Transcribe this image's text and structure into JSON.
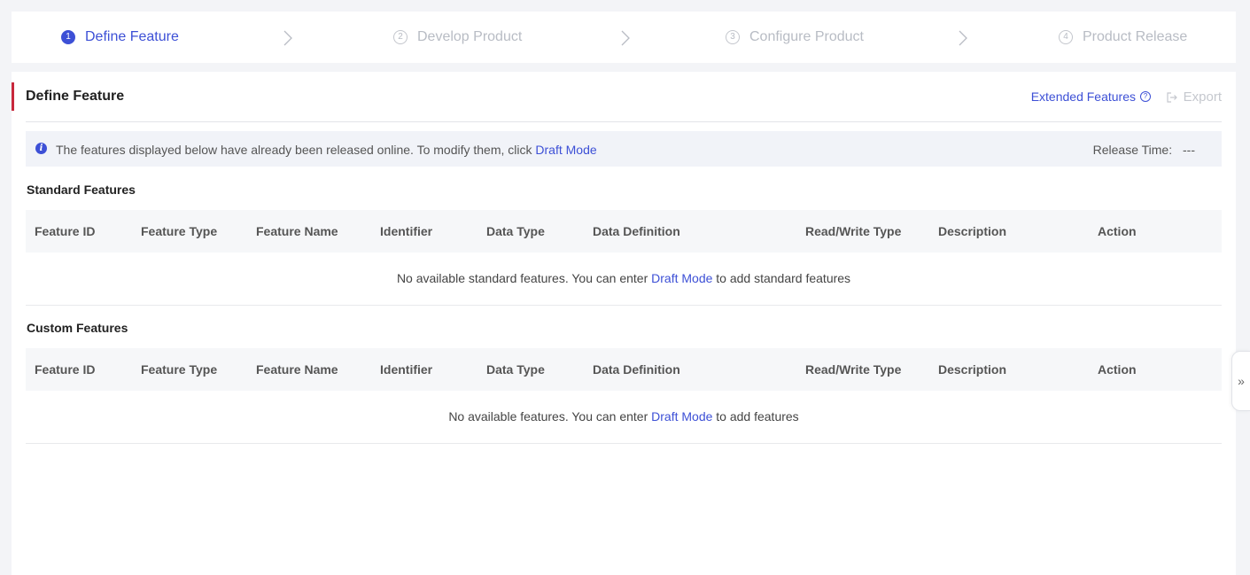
{
  "steps": [
    {
      "num": "1",
      "label": "Define Feature"
    },
    {
      "num": "2",
      "label": "Develop Product"
    },
    {
      "num": "3",
      "label": "Configure Product"
    },
    {
      "num": "4",
      "label": "Product Release"
    }
  ],
  "header": {
    "title": "Define Feature",
    "extended_label": "Extended Features",
    "help_glyph": "?",
    "export_label": "Export"
  },
  "notice": {
    "info_glyph": "i",
    "message": "The features displayed below have already been released online. To modify them, click",
    "draft_link": "Draft Mode",
    "release_label": "Release Time:",
    "release_value": "---"
  },
  "columns": [
    "Feature ID",
    "Feature Type",
    "Feature Name",
    "Identifier",
    "Data Type",
    "Data Definition",
    "Read/Write Type",
    "Description",
    "Action"
  ],
  "standard": {
    "title": "Standard Features",
    "empty_prefix": "No available standard features. You can enter",
    "empty_link": "Draft Mode",
    "empty_suffix": "to add standard features"
  },
  "custom": {
    "title": "Custom Features",
    "empty_prefix": "No available features. You can enter",
    "empty_link": "Draft Mode",
    "empty_suffix": "to add features"
  },
  "side_toggle": "»",
  "colors": {
    "accent": "#3d50d6",
    "title_bar": "#c8283c"
  }
}
